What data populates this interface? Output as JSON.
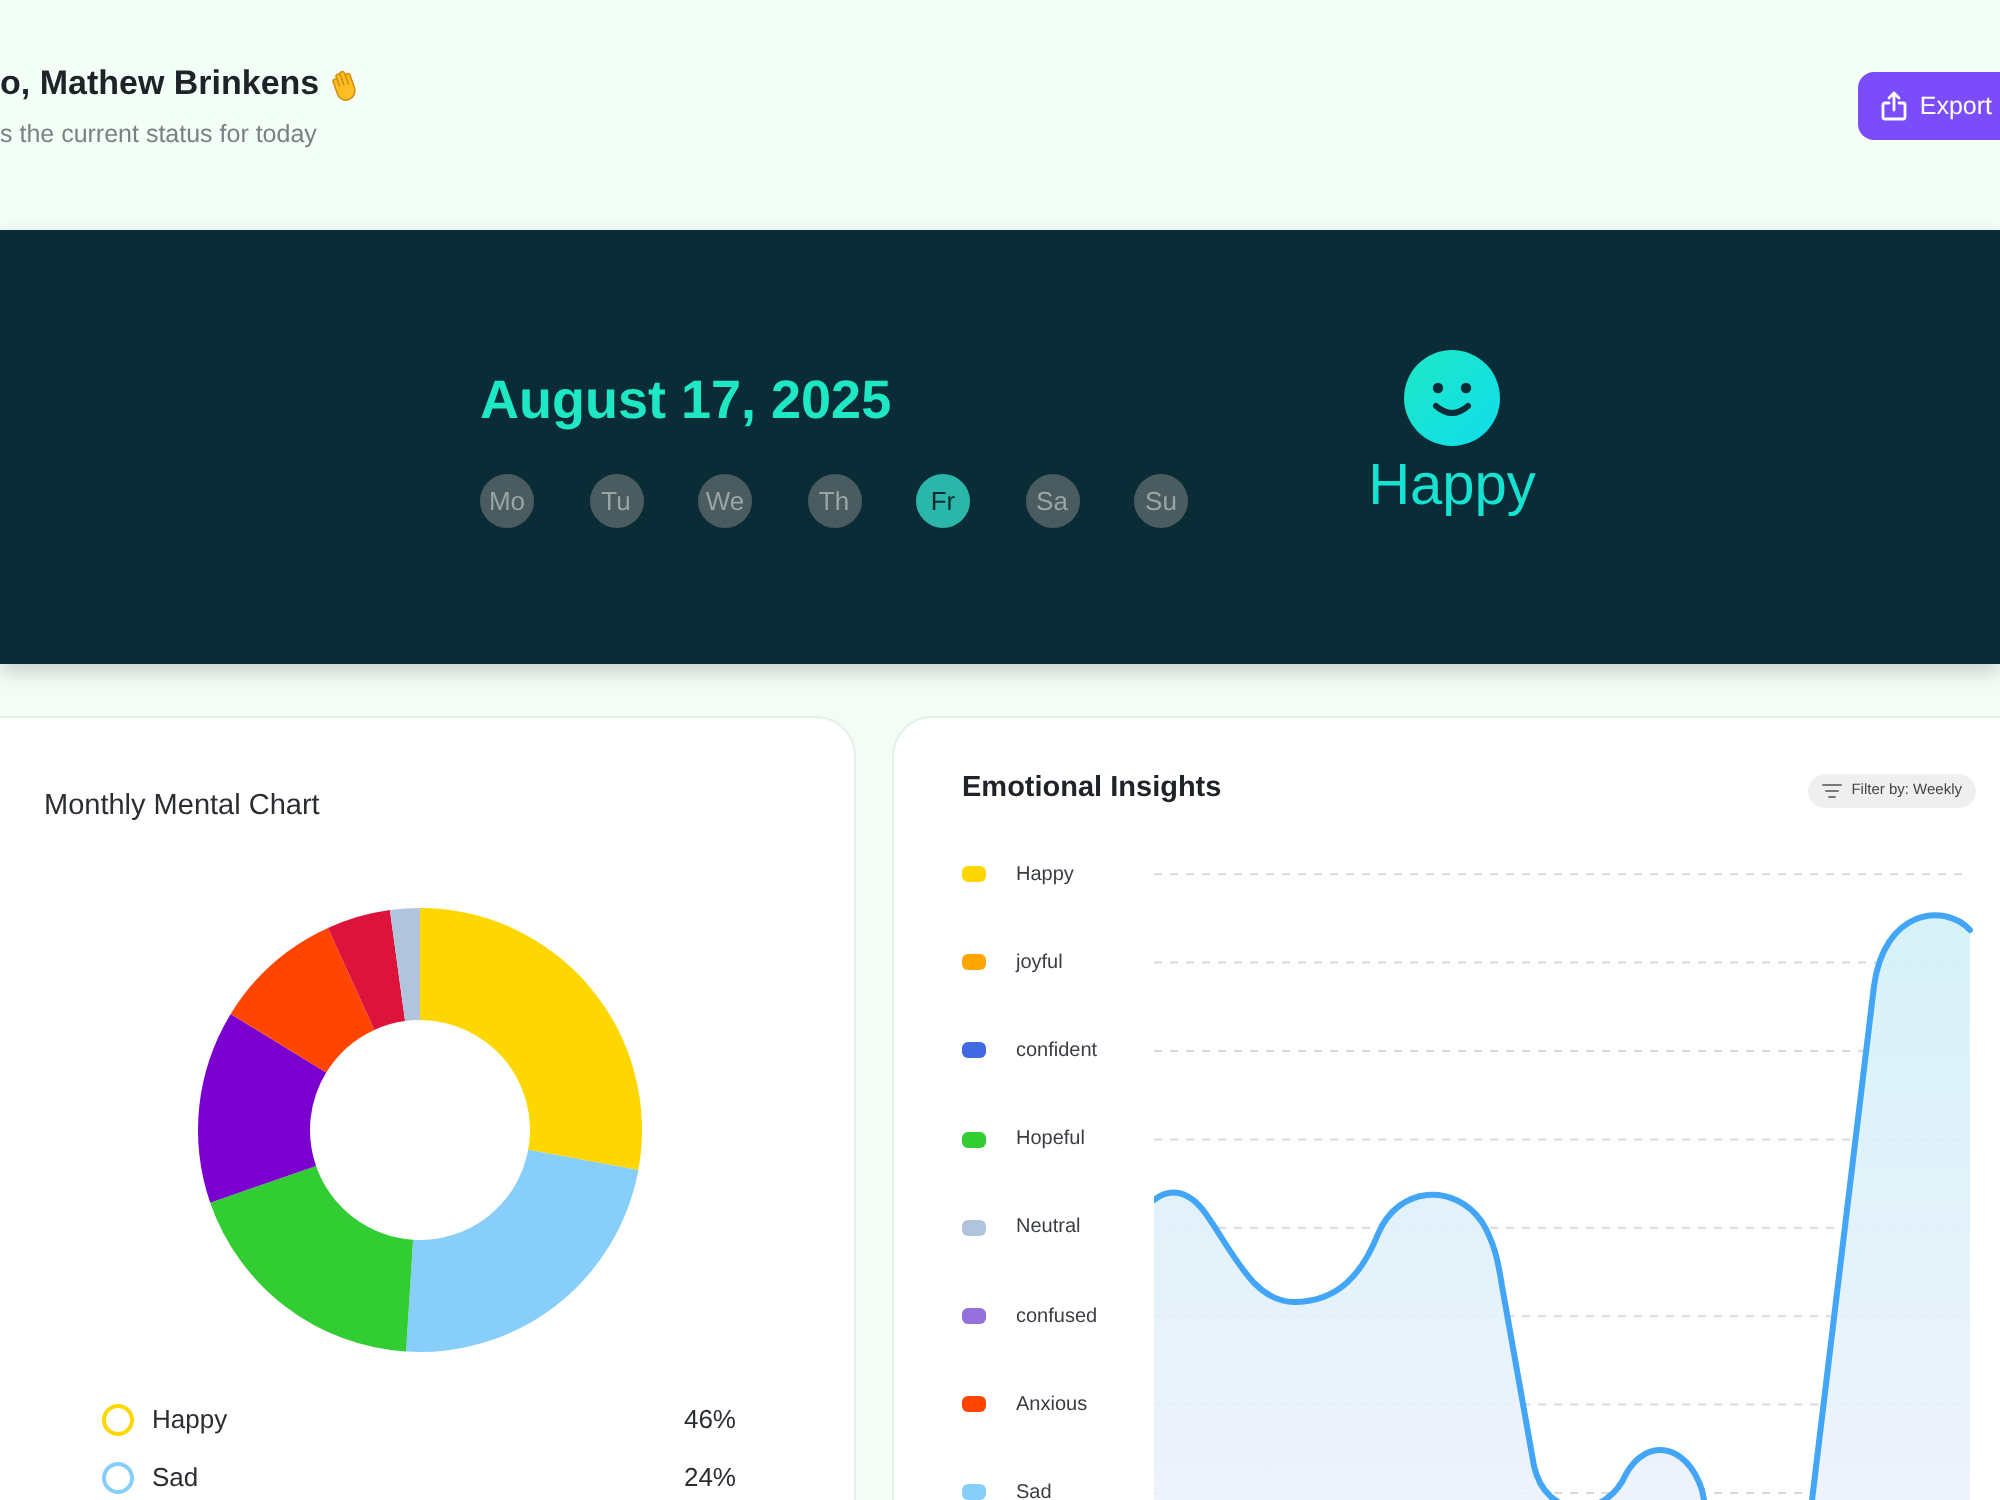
{
  "header": {
    "greeting": "o, Mathew Brinkens",
    "subtitle": "s the current status for today",
    "export_button": "Export"
  },
  "today": {
    "date": "August 17, 2025",
    "days": [
      {
        "label": "Mo",
        "selected": false
      },
      {
        "label": "Tu",
        "selected": false
      },
      {
        "label": "We",
        "selected": false
      },
      {
        "label": "Th",
        "selected": false
      },
      {
        "label": "Fr",
        "selected": true
      },
      {
        "label": "Sa",
        "selected": false
      },
      {
        "label": "Su",
        "selected": false
      }
    ],
    "mood": "Happy"
  },
  "monthly_chart": {
    "title": "Monthly Mental Chart",
    "legend": [
      {
        "label": "Happy",
        "value": "46%",
        "color": "#ffd700"
      },
      {
        "label": "Sad",
        "value": "24%",
        "color": "#87cefa"
      }
    ]
  },
  "emotional_insights": {
    "title": "Emotional Insights",
    "filter": "Filter by: Weekly",
    "legend": [
      {
        "label": "Happy",
        "color": "#ffd700"
      },
      {
        "label": "joyful",
        "color": "#ffa500"
      },
      {
        "label": "confident",
        "color": "#4169e1"
      },
      {
        "label": "Hopeful",
        "color": "#32cd32"
      },
      {
        "label": "Neutral",
        "color": "#b0c4de"
      },
      {
        "label": "confused",
        "color": "#9370db"
      },
      {
        "label": "Anxious",
        "color": "#ff4500"
      },
      {
        "label": "Sad",
        "color": "#87cefa"
      }
    ]
  }
}
